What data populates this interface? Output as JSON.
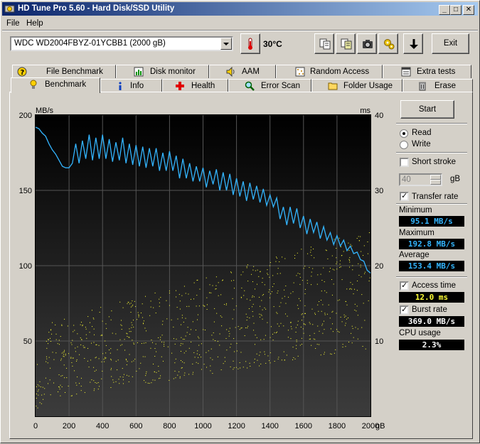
{
  "window": {
    "title": "HD Tune Pro 5.60 - Hard Disk/SSD Utility"
  },
  "menu": {
    "file": "File",
    "help": "Help"
  },
  "toolbar": {
    "drive": "WDC WD2004FBYZ-01YCBB1 (2000 gB)",
    "temperature": "30°C",
    "exit": "Exit"
  },
  "tabs_top": [
    {
      "label": "File Benchmark",
      "icon": "file-benchmark-icon"
    },
    {
      "label": "Disk monitor",
      "icon": "disk-monitor-icon"
    },
    {
      "label": "AAM",
      "icon": "speaker-icon"
    },
    {
      "label": "Random Access",
      "icon": "random-access-icon"
    },
    {
      "label": "Extra tests",
      "icon": "extra-tests-icon"
    }
  ],
  "tabs_bottom": [
    {
      "label": "Benchmark",
      "icon": "benchmark-icon",
      "active": true
    },
    {
      "label": "Info",
      "icon": "info-icon"
    },
    {
      "label": "Health",
      "icon": "health-cross-icon"
    },
    {
      "label": "Error Scan",
      "icon": "magnifier-icon"
    },
    {
      "label": "Folder Usage",
      "icon": "folder-icon"
    },
    {
      "label": "Erase",
      "icon": "trash-icon"
    }
  ],
  "controls": {
    "start": "Start",
    "read": "Read",
    "write": "Write",
    "mode": "read",
    "short_stroke": "Short stroke",
    "short_stroke_checked": false,
    "short_stroke_value": "40",
    "short_stroke_unit": "gB",
    "transfer_rate": "Transfer rate",
    "transfer_rate_checked": true,
    "access_time": "Access time",
    "access_time_checked": true,
    "burst_rate": "Burst rate",
    "burst_rate_checked": true
  },
  "stats": {
    "minimum_label": "Minimum",
    "minimum": "95.1 MB/s",
    "maximum_label": "Maximum",
    "maximum": "192.8 MB/s",
    "average_label": "Average",
    "average": "153.4 MB/s",
    "access_time": "12.0 ms",
    "burst_rate": "369.0 MB/s",
    "cpu_usage_label": "CPU usage",
    "cpu_usage": "2.3%"
  },
  "chart_data": {
    "type": "line",
    "ylabel_left": "MB/s",
    "ylabel_right": "ms",
    "x_unit": "gB",
    "xlim": [
      0,
      2000
    ],
    "ylim_left": [
      0,
      200
    ],
    "ylim_right": [
      0,
      40
    ],
    "x_ticks": [
      0,
      200,
      400,
      600,
      800,
      1000,
      1200,
      1400,
      1600,
      1800,
      2000
    ],
    "y_ticks_left": [
      50,
      100,
      150,
      200
    ],
    "y_ticks_right": [
      10,
      20,
      30,
      40
    ],
    "grid": true,
    "series": [
      {
        "color": "#33b5ff",
        "x": [
          0,
          20,
          40,
          60,
          80,
          100,
          120,
          140,
          160,
          180,
          200,
          220,
          240,
          260,
          280,
          300,
          320,
          340,
          360,
          380,
          400,
          420,
          440,
          460,
          480,
          500,
          520,
          540,
          560,
          580,
          600,
          620,
          640,
          660,
          680,
          700,
          720,
          740,
          760,
          780,
          800,
          820,
          840,
          860,
          880,
          900,
          920,
          940,
          960,
          980,
          1000,
          1020,
          1040,
          1060,
          1080,
          1100,
          1120,
          1140,
          1160,
          1180,
          1200,
          1220,
          1240,
          1260,
          1280,
          1300,
          1320,
          1340,
          1360,
          1380,
          1400,
          1420,
          1440,
          1460,
          1480,
          1500,
          1520,
          1540,
          1560,
          1580,
          1600,
          1620,
          1640,
          1660,
          1680,
          1700,
          1720,
          1740,
          1760,
          1780,
          1800,
          1820,
          1840,
          1860,
          1880,
          1900,
          1920,
          1940,
          1960,
          1980,
          2000
        ],
        "values": [
          192,
          191,
          188,
          186,
          181,
          177,
          174,
          170,
          166,
          165,
          165,
          168,
          181,
          168,
          183,
          171,
          187,
          170,
          185,
          171,
          187,
          171,
          184,
          169,
          182,
          170,
          185,
          168,
          181,
          167,
          180,
          166,
          179,
          165,
          178,
          166,
          178,
          163,
          175,
          163,
          176,
          163,
          173,
          158,
          171,
          158,
          168,
          156,
          166,
          156,
          165,
          152,
          163,
          154,
          164,
          150,
          162,
          150,
          161,
          147,
          158,
          146,
          156,
          143,
          155,
          144,
          153,
          142,
          151,
          140,
          147,
          139,
          145,
          131,
          139,
          127,
          139,
          128,
          138,
          125,
          133,
          121,
          131,
          122,
          129,
          118,
          126,
          117,
          122,
          114,
          120,
          113,
          117,
          110,
          113,
          108,
          109,
          104,
          103,
          97,
          95.1
        ]
      }
    ],
    "access_time_scatter": {
      "color": "#ffff33",
      "unit": "ms",
      "description_range_ms": [
        3,
        27
      ]
    }
  }
}
